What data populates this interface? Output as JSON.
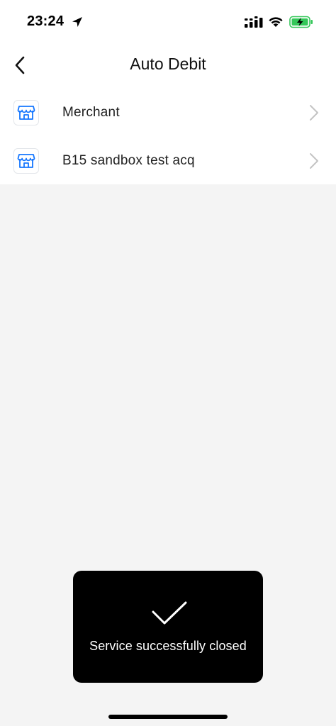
{
  "status_bar": {
    "time": "23:24",
    "icons": [
      "location-arrow-icon",
      "signal-icon",
      "wifi-icon",
      "battery-charging-icon"
    ],
    "battery_color": "#34c759"
  },
  "header": {
    "title": "Auto Debit",
    "back_icon": "chevron-left-icon"
  },
  "list": {
    "items": [
      {
        "label": "Merchant",
        "icon": "store-icon"
      },
      {
        "label": "B15 sandbox test acq",
        "icon": "store-icon"
      }
    ],
    "icon_color": "#1677ff"
  },
  "toast": {
    "icon": "checkmark-icon",
    "message": "Service successfully closed"
  },
  "colors": {
    "background": "#f4f4f4",
    "surface": "#ffffff",
    "toast_bg": "#000000"
  }
}
